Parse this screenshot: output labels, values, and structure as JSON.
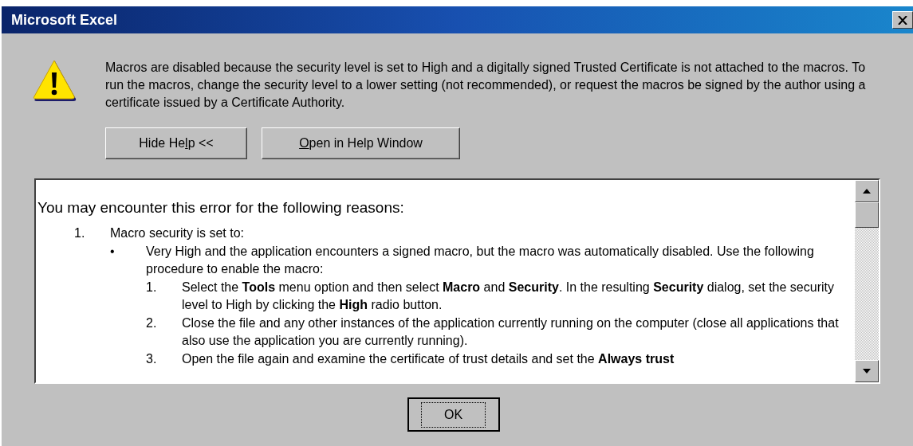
{
  "window": {
    "title": "Microsoft Excel"
  },
  "message": {
    "text": "Macros are disabled because the security level is set to High and a digitally signed Trusted Certificate is not attached to the macros. To run the macros, change the security level to a lower setting (not recommended), or request the macros be signed by the author using a certificate issued by a Certificate Authority."
  },
  "buttons": [
    {
      "before": "Hide He",
      "access_key": "l",
      "after": "p <<"
    },
    {
      "access_key": "O",
      "after": "pen in Help Window"
    }
  ],
  "help": {
    "heading": "You may encounter this error for the following reasons:",
    "items": [
      {
        "marker": "1.",
        "text": "Macro security is set to:",
        "children": [
          {
            "marker": "•",
            "text": "Very High and the application encounters a signed macro, but the macro was automatically disabled. Use the following procedure to enable the macro:",
            "children": [
              {
                "marker": "1.",
                "text": "Select the **Tools** menu option and then select **Macro** and **Security**. In the resulting **Security** dialog, set the security level to High by clicking the **High** radio button."
              },
              {
                "marker": "2.",
                "text": "Close the file and any other instances of the application currently running on the computer (close all applications that also use the application you are currently running)."
              },
              {
                "marker": "3.",
                "text": "Open the file again and examine the certificate of trust details and set the **Always trust**"
              }
            ]
          }
        ]
      }
    ]
  },
  "ok_button": {
    "label": "OK",
    "focused": true
  }
}
